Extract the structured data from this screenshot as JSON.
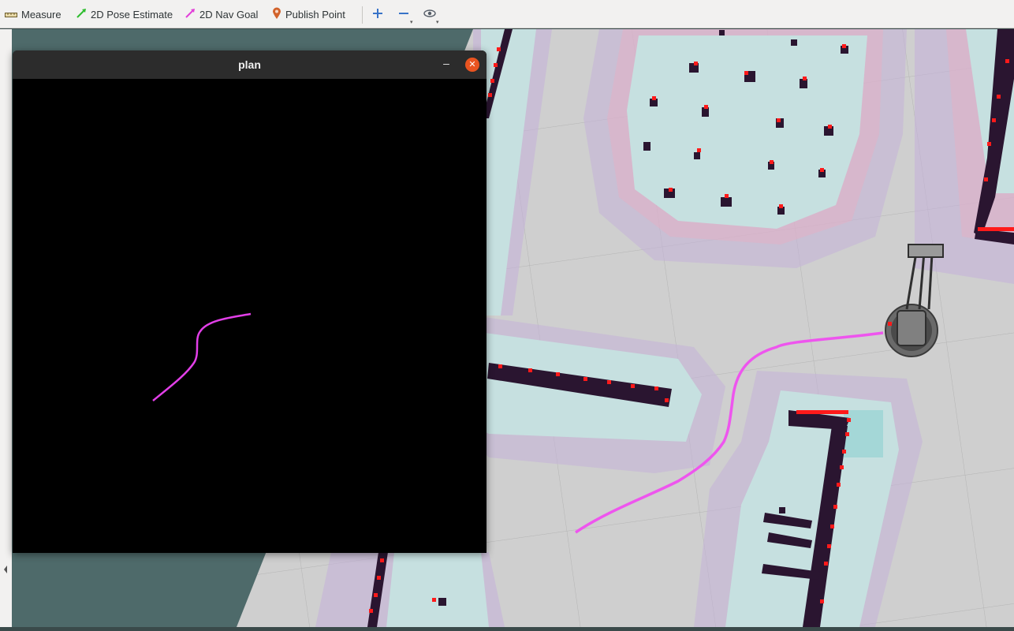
{
  "toolbar": {
    "tools": [
      {
        "label": "Measure",
        "icon": "ruler-icon"
      },
      {
        "label": "2D Pose Estimate",
        "icon": "green-arrow-icon"
      },
      {
        "label": "2D Nav Goal",
        "icon": "magenta-arrow-icon"
      },
      {
        "label": "Publish Point",
        "icon": "location-pin-icon"
      }
    ],
    "view_buttons": [
      "zoom-in-icon",
      "zoom-out-icon",
      "eye-icon"
    ]
  },
  "plan_window": {
    "title": "plan",
    "minimize_glyph": "–",
    "close_glyph": "✕"
  },
  "colors": {
    "path": "#ee55ee",
    "close": "#e95420",
    "grid_background": "#cfcfcf",
    "free_space": "#c8e1e1",
    "obstacle": "#2a1530",
    "laser": "#ff0000"
  }
}
